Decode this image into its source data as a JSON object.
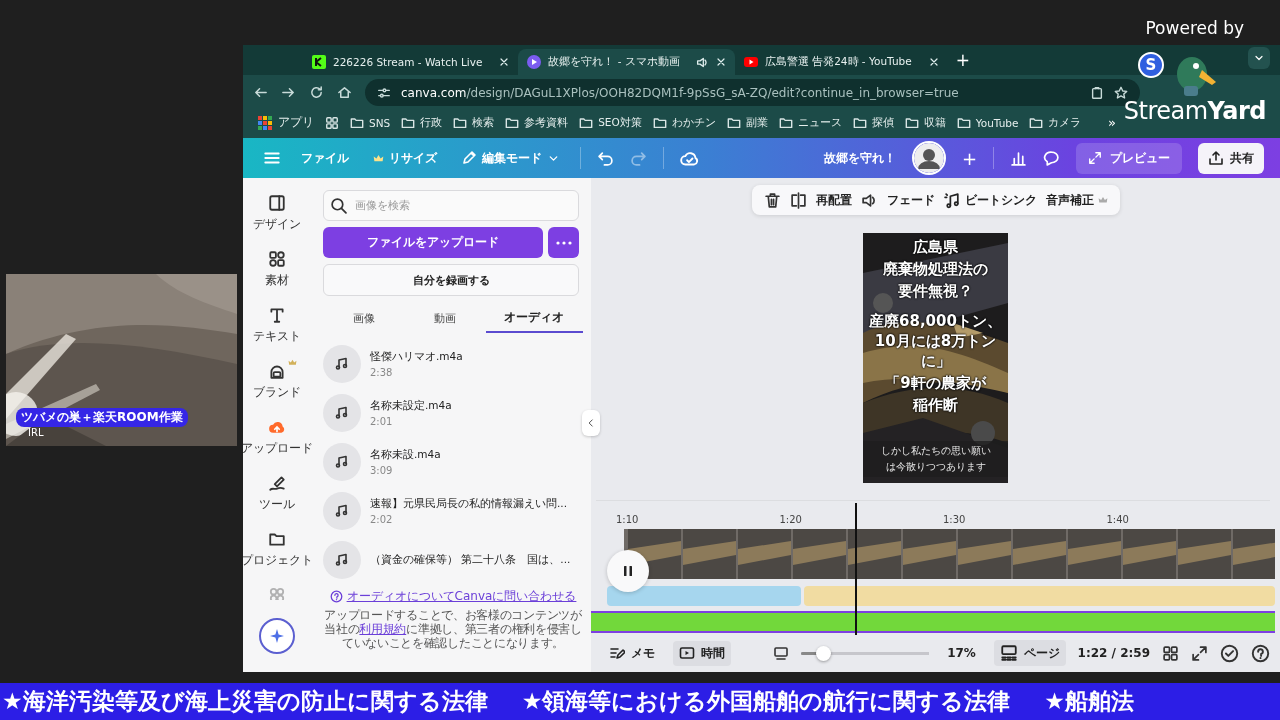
{
  "stream": {
    "powered_by": "Powered by",
    "brand": "Stream**Yard**",
    "logo_badge": "S"
  },
  "webcam": {
    "title": "ツバメの巣＋楽天ROOM作業",
    "tag": "IRL"
  },
  "browser": {
    "tabs": [
      {
        "title": "226226 Stream - Watch Live",
        "kind": "kick",
        "selected": false,
        "audio": false
      },
      {
        "title": "故郷を守れ！ - スマホ動画",
        "kind": "canva",
        "selected": true,
        "audio": true
      },
      {
        "title": "広島警選 告発24時 - YouTube",
        "kind": "youtube",
        "selected": false,
        "audio": false
      }
    ],
    "new_tab": "+",
    "url_host": "canva.com",
    "url_path": "/design/DAGuL1XPlos/OOH82DQM1f-9pSsG_sA-ZQ/edit?continue_in_browser=true",
    "apps_label": "アプリ",
    "bookmarks": [
      "SNS",
      "行政",
      "検索",
      "参考資料",
      "SEO対策",
      "わかチン",
      "副業",
      "ニュース",
      "探偵",
      "収籍",
      "YouTube",
      "カメラ"
    ],
    "more": "»"
  },
  "canva": {
    "file": "ファイル",
    "resize": "リサイズ",
    "edit_mode": "編集モード",
    "title": "故郷を守れ！",
    "add": "+",
    "preview": "プレビュー",
    "share": "共有"
  },
  "rail": [
    {
      "label": "デザイン",
      "kind": "design",
      "selected": false
    },
    {
      "label": "素材",
      "kind": "elements",
      "selected": false
    },
    {
      "label": "テキスト",
      "kind": "text",
      "selected": false
    },
    {
      "label": "ブランド",
      "kind": "brand",
      "selected": false
    },
    {
      "label": "アップロード",
      "kind": "upload",
      "selected": true
    },
    {
      "label": "ツール",
      "kind": "draw",
      "selected": false
    },
    {
      "label": "プロジェクト",
      "kind": "folder",
      "selected": false
    },
    {
      "kind": "apps",
      "selected": false
    }
  ],
  "panel": {
    "search": {
      "placeholder": "画像を検索"
    },
    "upload": "ファイルをアップロード",
    "record": "自分を録画する",
    "tabs": [
      {
        "label": "画像",
        "selected": false
      },
      {
        "label": "動画",
        "selected": false
      },
      {
        "label": "オーディオ",
        "selected": true
      }
    ],
    "files": [
      {
        "title": "怪傑ハリマオ.m4a",
        "duration": "2:38"
      },
      {
        "title": "名称未設定.m4a",
        "duration": "2:01"
      },
      {
        "title": "名称未設.m4a",
        "duration": "3:09"
      },
      {
        "title": "速報】元県民局長の私的情報漏えい問...",
        "duration": "2:02"
      },
      {
        "title": "（資金の確保等） 第二十八条　国は、..."
      }
    ],
    "help_link": "オーディオについてCanvaに問い合わせる",
    "notice": "アップロードすることで、お客様のコンテンツが当社の",
    "notice_link": "利用規約",
    "notice_end": "に準拠し、第三者の権利を侵害していないことを確認したことになります。"
  },
  "context_toolbar": {
    "rearrange": "再配置",
    "fade": "フェード",
    "beat_sync": "ビートシンク",
    "enhance": "音声補正"
  },
  "design": {
    "lines": [
      "広島県",
      "廃棄物処理法の",
      "要件無視？",
      "産廃68,000トン、10月には8万トンに」",
      "「9軒の農家が",
      "稲作断"
    ],
    "caption": [
      "しかし私たちの思い願い",
      "は今散りつつあります"
    ]
  },
  "timeline": {
    "ticks": [
      "1:10",
      "1:20",
      "1:30",
      "1:40"
    ],
    "playing": true,
    "clips": [
      {
        "color": "#a6d6ee"
      },
      {
        "color": "#f1dca2"
      }
    ]
  },
  "footer": {
    "notes": "メモ",
    "timer": {
      "label": "時間",
      "selected": true
    },
    "zoom": {
      "level": 0.17,
      "reading": "17%"
    },
    "pages": {
      "label": "ページ",
      "selected": true
    },
    "time": "1:22 / 2:59"
  },
  "ticker": [
    "★海洋汚染等及び海上災害の防止に関する法律",
    "★領海等における外国船舶の航行に関する法律",
    "★船舶法"
  ]
}
